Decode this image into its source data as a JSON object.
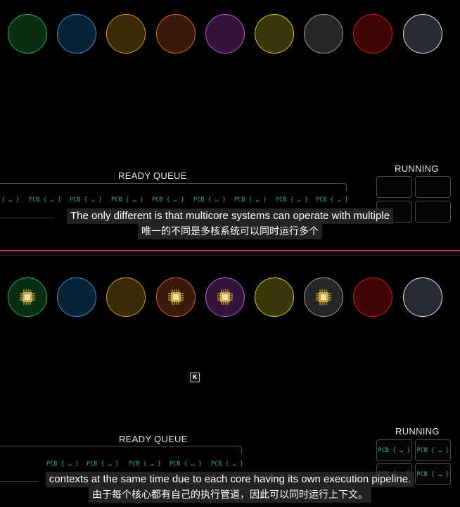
{
  "top": {
    "ready_queue_label": "READY QUEUE",
    "running_label": "RUNNING",
    "cores": [
      {
        "name": "core-1",
        "fill": "#0a2e14",
        "stroke": "#31a84f",
        "has_chip": false
      },
      {
        "name": "core-2",
        "fill": "#0a2236",
        "stroke": "#3a8fd0",
        "has_chip": false
      },
      {
        "name": "core-3",
        "fill": "#3a2a07",
        "stroke": "#d49a2a",
        "has_chip": false
      },
      {
        "name": "core-4",
        "fill": "#3a1a0c",
        "stroke": "#d4682a",
        "has_chip": false
      },
      {
        "name": "core-5",
        "fill": "#33153a",
        "stroke": "#b65ac8",
        "has_chip": false
      },
      {
        "name": "core-6",
        "fill": "#38360a",
        "stroke": "#d2cc2a",
        "has_chip": false
      },
      {
        "name": "core-7",
        "fill": "#262626",
        "stroke": "#9a9a9a",
        "has_chip": false
      },
      {
        "name": "core-8",
        "fill": "#3e0406",
        "stroke": "#c81e24",
        "has_chip": false
      },
      {
        "name": "core-9",
        "fill": "#252a33",
        "stroke": "#e8e8e8",
        "has_chip": false
      }
    ],
    "queue_items": [
      "{ … }",
      "PCB { … }",
      "PCB { … }",
      "PCB { … }",
      "PCB { … }",
      "PCB { … }",
      "PCB { … }",
      "PCB { … }",
      "PCB { … }"
    ],
    "running_slots": [
      "",
      "",
      "",
      ""
    ],
    "subtitle_en": "The only different is that multicore systems can operate with multiple",
    "subtitle_cn": "唯一的不同是多核系统可以同时运行多个"
  },
  "bottom": {
    "ready_queue_label": "READY QUEUE",
    "running_label": "RUNNING",
    "cores": [
      {
        "name": "core-1",
        "fill": "#0a2e14",
        "stroke": "#31a84f",
        "has_chip": true
      },
      {
        "name": "core-2",
        "fill": "#0a2236",
        "stroke": "#3a8fd0",
        "has_chip": false
      },
      {
        "name": "core-3",
        "fill": "#3a2a07",
        "stroke": "#d49a2a",
        "has_chip": false
      },
      {
        "name": "core-4",
        "fill": "#3a1a0c",
        "stroke": "#d4682a",
        "has_chip": true
      },
      {
        "name": "core-5",
        "fill": "#33153a",
        "stroke": "#b65ac8",
        "has_chip": true
      },
      {
        "name": "core-6",
        "fill": "#38360a",
        "stroke": "#d2cc2a",
        "has_chip": false
      },
      {
        "name": "core-7",
        "fill": "#262626",
        "stroke": "#9a9a9a",
        "has_chip": true
      },
      {
        "name": "core-8",
        "fill": "#3e0406",
        "stroke": "#c81e24",
        "has_chip": false
      },
      {
        "name": "core-9",
        "fill": "#252a33",
        "stroke": "#e8e8e8",
        "has_chip": false
      }
    ],
    "queue_items": [
      "PCB { … }",
      "PCB { … }",
      "PCB { … }",
      "PCB { … }",
      "PCB { … }"
    ],
    "running_slots": [
      "PCB { … }",
      "PCB { … }",
      "PCB { … }",
      "PCB { … }"
    ],
    "subtitle_en": "contexts at the same time due to each core having its own execution pipeline.",
    "subtitle_cn": "由于每个核心都有自己的执行管道，因此可以同时运行上下文。"
  },
  "cursor_icon_glyph": "K",
  "divider_color": "#b0365e",
  "chip_color": "#c9a83a",
  "pcb_color": "#3fa88a"
}
